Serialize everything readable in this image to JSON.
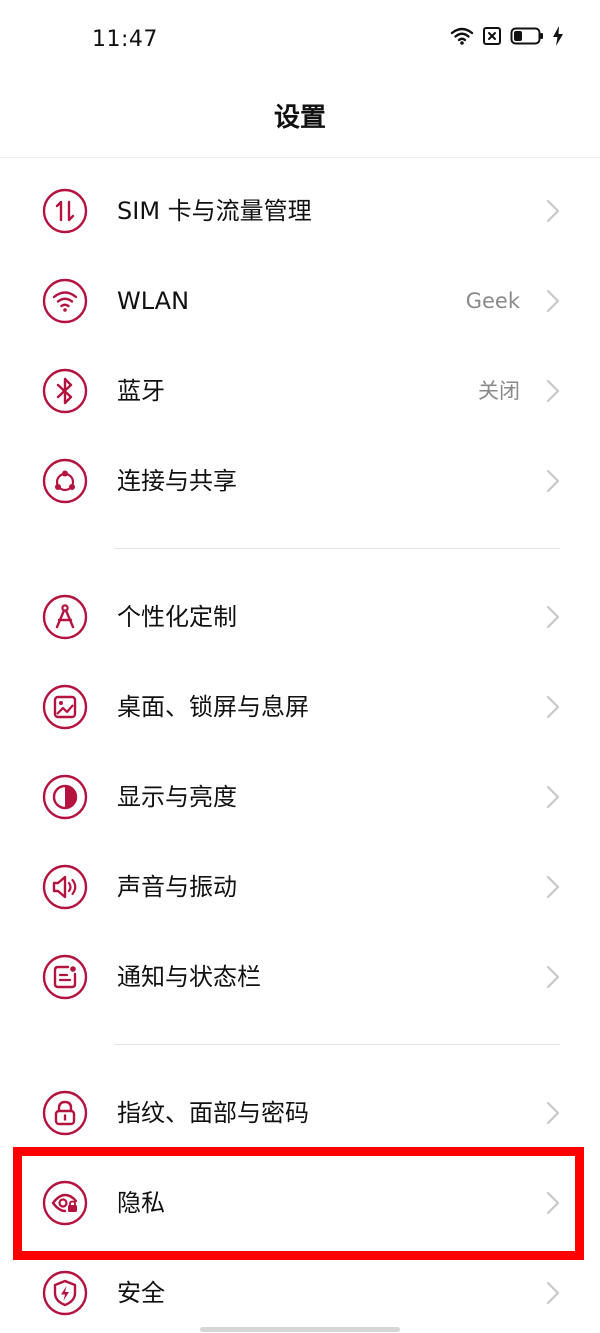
{
  "status_bar": {
    "time": "11:47",
    "icons": [
      "wifi-icon",
      "no-sim-icon",
      "battery-icon",
      "charging-icon"
    ]
  },
  "header": {
    "title": "设置"
  },
  "colors": {
    "accent": "#b5133f",
    "highlight": "#ff0000",
    "chevron": "#c8c8c8",
    "value_text": "#8a8a8a"
  },
  "groups": [
    {
      "items": [
        {
          "label": "SIM 卡与流量管理",
          "value": "",
          "icon": "sim-data-icon"
        },
        {
          "label": "WLAN",
          "value": "Geek",
          "icon": "wifi-icon"
        },
        {
          "label": "蓝牙",
          "value": "关闭",
          "icon": "bluetooth-icon"
        },
        {
          "label": "连接与共享",
          "value": "",
          "icon": "share-icon"
        }
      ]
    },
    {
      "items": [
        {
          "label": "个性化定制",
          "value": "",
          "icon": "compass-icon"
        },
        {
          "label": "桌面、锁屏与息屏",
          "value": "",
          "icon": "wallpaper-icon"
        },
        {
          "label": "显示与亮度",
          "value": "",
          "icon": "brightness-icon"
        },
        {
          "label": "声音与振动",
          "value": "",
          "icon": "speaker-icon"
        },
        {
          "label": "通知与状态栏",
          "value": "",
          "icon": "notification-icon"
        }
      ]
    },
    {
      "items": [
        {
          "label": "指纹、面部与密码",
          "value": "",
          "icon": "lock-icon"
        },
        {
          "label": "隐私",
          "value": "",
          "icon": "privacy-eye-icon"
        },
        {
          "label": "安全",
          "value": "",
          "icon": "security-shield-icon"
        }
      ]
    }
  ]
}
